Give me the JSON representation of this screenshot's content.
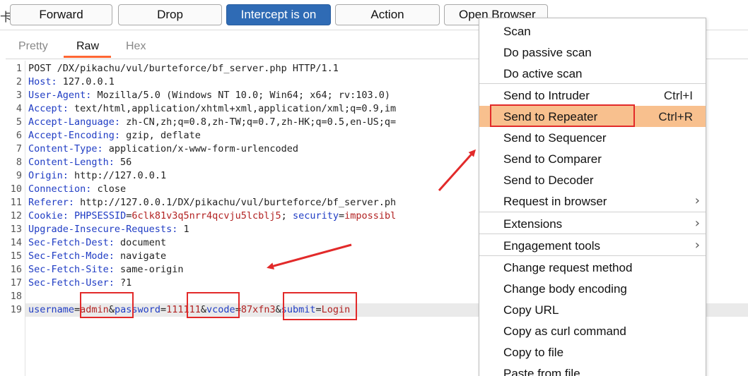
{
  "toolbar": {
    "left_glyph": "卡",
    "buttons": [
      {
        "label": "Forward",
        "active": false
      },
      {
        "label": "Drop",
        "active": false
      },
      {
        "label": "Intercept is on",
        "active": true
      },
      {
        "label": "Action",
        "active": false
      },
      {
        "label": "Open Browser",
        "active": false
      }
    ]
  },
  "tabs": [
    {
      "label": "Pretty",
      "active": false
    },
    {
      "label": "Raw",
      "active": true
    },
    {
      "label": "Hex",
      "active": false
    }
  ],
  "request_lines": [
    {
      "n": "1",
      "key": "",
      "value": "POST /DX/pikachu/vul/burteforce/bf_server.php HTTP/1.1"
    },
    {
      "n": "2",
      "key": "Host:",
      "value": " 127.0.0.1"
    },
    {
      "n": "3",
      "key": "User-Agent:",
      "value": " Mozilla/5.0 (Windows NT 10.0; Win64; x64; rv:103.0)"
    },
    {
      "n": "4",
      "key": "Accept:",
      "value": " text/html,application/xhtml+xml,application/xml;q=0.9,im"
    },
    {
      "n": "5",
      "key": "Accept-Language:",
      "value": " zh-CN,zh;q=0.8,zh-TW;q=0.7,zh-HK;q=0.5,en-US;q="
    },
    {
      "n": "6",
      "key": "Accept-Encoding:",
      "value": " gzip, deflate"
    },
    {
      "n": "7",
      "key": "Content-Type:",
      "value": " application/x-www-form-urlencoded"
    },
    {
      "n": "8",
      "key": "Content-Length:",
      "value": " 56"
    },
    {
      "n": "9",
      "key": "Origin:",
      "value": " http://127.0.0.1"
    },
    {
      "n": "10",
      "key": "Connection:",
      "value": " close"
    },
    {
      "n": "11",
      "key": "Referer:",
      "value": " http://127.0.0.1/DX/pikachu/vul/burteforce/bf_server.ph"
    },
    {
      "n": "12",
      "key": "Cookie:",
      "value": ""
    },
    {
      "n": "13",
      "key": "Upgrade-Insecure-Requests:",
      "value": " 1"
    },
    {
      "n": "14",
      "key": "Sec-Fetch-Dest:",
      "value": " document"
    },
    {
      "n": "15",
      "key": "Sec-Fetch-Mode:",
      "value": " navigate"
    },
    {
      "n": "16",
      "key": "Sec-Fetch-Site:",
      "value": " same-origin"
    },
    {
      "n": "17",
      "key": "Sec-Fetch-User:",
      "value": " ?1"
    },
    {
      "n": "18",
      "key": "",
      "value": ""
    },
    {
      "n": "19",
      "key": "",
      "value": ""
    }
  ],
  "cookie": {
    "k1": "PHPSESSID",
    "v1": "6clk81v3q5nrr4qcvju5lcblj5",
    "sep": "; ",
    "k2": "security",
    "v2": "impossibl"
  },
  "body_params": [
    {
      "key": "username",
      "value": "admin"
    },
    {
      "key": "password",
      "value": "111111"
    },
    {
      "key": "vcode",
      "value": "87xfn3"
    },
    {
      "key": "submit",
      "value": "Login"
    }
  ],
  "context_menu": {
    "items": [
      {
        "label": "Scan",
        "shortcut": "",
        "submenu": false
      },
      {
        "label": "Do passive scan",
        "shortcut": "",
        "submenu": false
      },
      {
        "label": "Do active scan",
        "shortcut": "",
        "submenu": false
      },
      {
        "label": "Send to Intruder",
        "shortcut": "Ctrl+I",
        "submenu": false
      },
      {
        "label": "Send to Repeater",
        "shortcut": "Ctrl+R",
        "submenu": false,
        "selected": true
      },
      {
        "label": "Send to Sequencer",
        "shortcut": "",
        "submenu": false
      },
      {
        "label": "Send to Comparer",
        "shortcut": "",
        "submenu": false
      },
      {
        "label": "Send to Decoder",
        "shortcut": "",
        "submenu": false
      },
      {
        "label": "Request in browser",
        "shortcut": "",
        "submenu": true
      },
      {
        "label": "Extensions",
        "shortcut": "",
        "submenu": true
      },
      {
        "label": "Engagement tools",
        "shortcut": "",
        "submenu": true
      },
      {
        "label": "Change request method",
        "shortcut": "",
        "submenu": false
      },
      {
        "label": "Change body encoding",
        "shortcut": "",
        "submenu": false
      },
      {
        "label": "Copy URL",
        "shortcut": "",
        "submenu": false
      },
      {
        "label": "Copy as curl command",
        "shortcut": "",
        "submenu": false
      },
      {
        "label": "Copy to file",
        "shortcut": "",
        "submenu": false
      },
      {
        "label": "Paste from file",
        "shortcut": "",
        "submenu": false
      }
    ]
  },
  "colors": {
    "accent_on": "#2f6bb5",
    "menu_selected": "#f8c08e",
    "annotation_red": "#e22a2a",
    "tab_underline": "#ff6633",
    "header_key": "#1f3cc4",
    "param_value": "#b22222"
  },
  "icons": {
    "submenu": "chevron-right-icon"
  }
}
